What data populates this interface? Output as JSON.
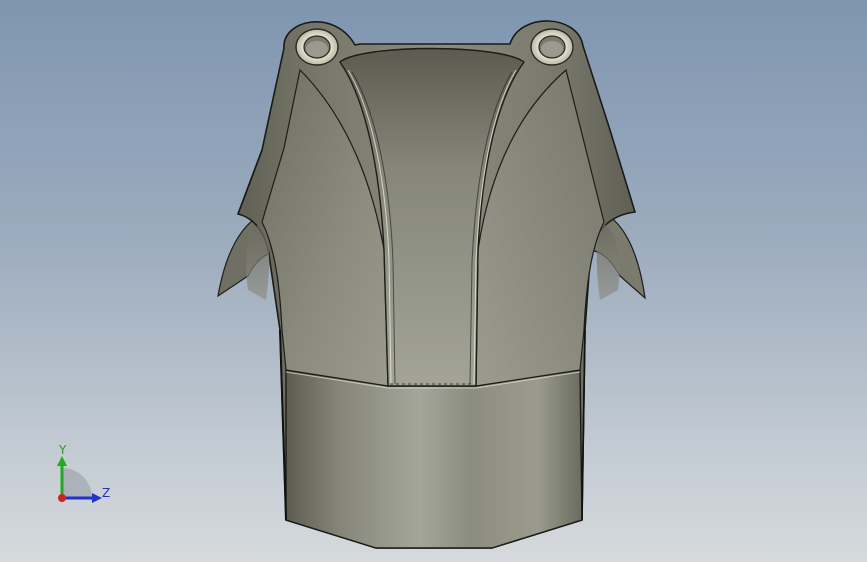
{
  "viewport": {
    "background_top": "#7f95b0",
    "background_bottom": "#d6dadc"
  },
  "model": {
    "shell_color": "#8a8a7c",
    "hole_ring_color": "#dcdcc8"
  },
  "triad": {
    "y_label": "Y",
    "z_label": "Z",
    "y_color": "#22aa22",
    "z_color": "#2233cc",
    "x_color": "#cc2222"
  }
}
